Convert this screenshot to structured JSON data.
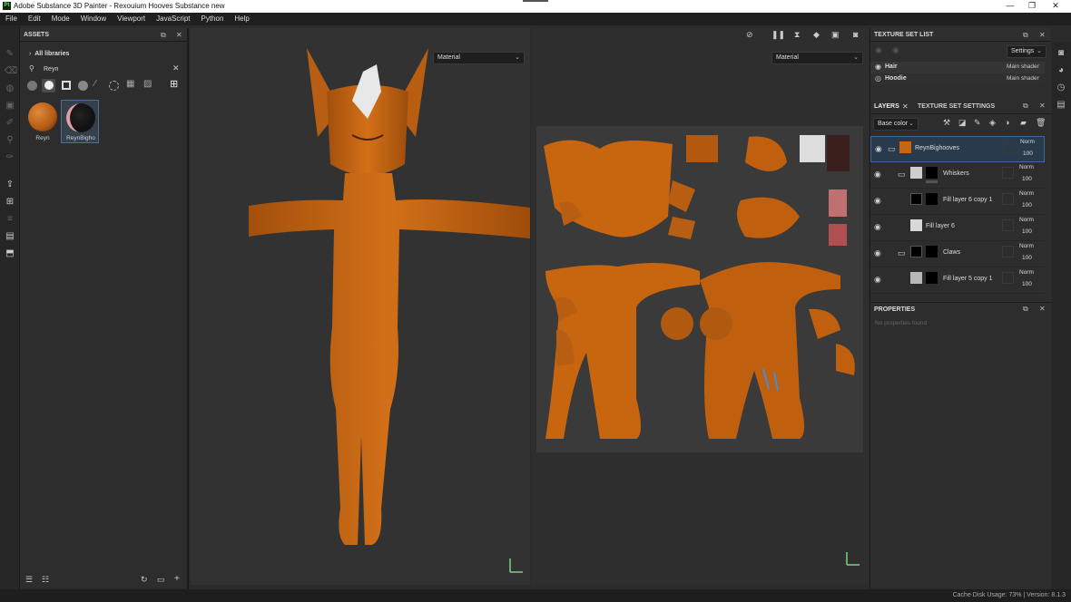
{
  "window": {
    "title": "Adobe Substance 3D Painter - Rexouium Hooves Substance new",
    "app_icon_text": "Pt",
    "minimize": "—",
    "maximize": "❐",
    "close": "✕"
  },
  "menu": [
    "File",
    "Edit",
    "Mode",
    "Window",
    "Viewport",
    "JavaScript",
    "Python",
    "Help"
  ],
  "assets": {
    "title": "ASSETS",
    "breadcrumb": "All libraries",
    "search_value": "Reyn",
    "items": [
      {
        "label": "Reyn"
      },
      {
        "label": "ReynBigho"
      }
    ],
    "preview_label": "ReynBighooves"
  },
  "viewport": {
    "material_left": "Material",
    "material_right": "Material"
  },
  "texture_set_list": {
    "title": "TEXTURE SET LIST",
    "settings": "Settings",
    "sets": [
      {
        "name": "Hair",
        "shader": "Main shader"
      },
      {
        "name": "Hoodie",
        "shader": "Main shader"
      }
    ]
  },
  "layers_panel": {
    "tab_layers": "LAYERS",
    "tab_settings": "TEXTURE SET SETTINGS",
    "channel": "Base color",
    "layers": [
      {
        "name": "ReynBighooves",
        "blend": "Norm",
        "opacity": "100"
      },
      {
        "name": "Whiskers",
        "blend": "Norm",
        "opacity": "100"
      },
      {
        "name": "Fill layer 6 copy 1",
        "blend": "Norm",
        "opacity": "100"
      },
      {
        "name": "Fill layer 6",
        "blend": "Norm",
        "opacity": "100"
      },
      {
        "name": "Claws",
        "blend": "Norm",
        "opacity": "100"
      },
      {
        "name": "Fill layer 5 copy 1",
        "blend": "Norm",
        "opacity": "100"
      }
    ]
  },
  "properties": {
    "title": "PROPERTIES",
    "empty": "No properties found"
  },
  "status": {
    "text": "Cache Disk Usage:   73% | Version: 8.1.3"
  },
  "colors": {
    "fur": "#c8650f",
    "accent": "#3d8fd8"
  }
}
